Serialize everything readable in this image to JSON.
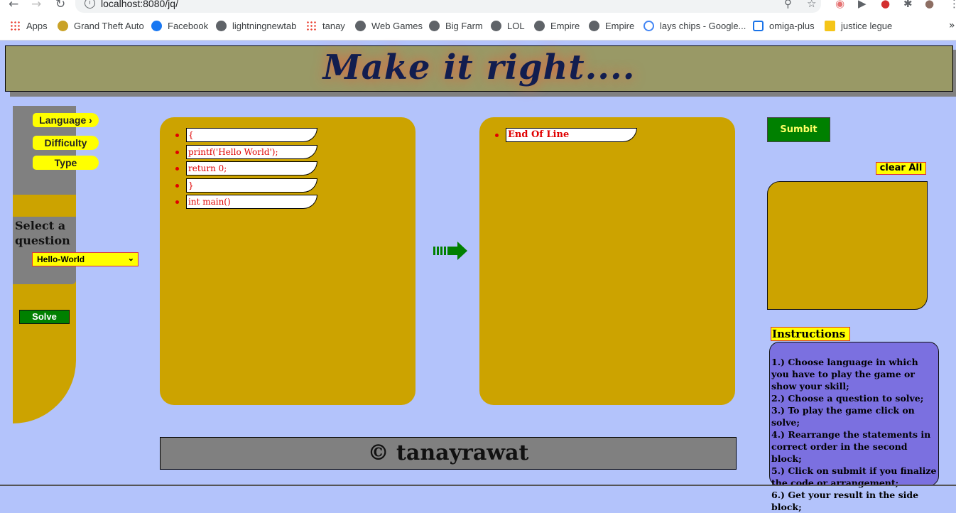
{
  "browser": {
    "url": "localhost:8080/jq/",
    "bookmarks": [
      "Apps",
      "Grand Theft Auto",
      "Facebook",
      "lightningnewtab",
      "tanay",
      "Web Games",
      "Big Farm",
      "LOL",
      "Empire",
      "Empire",
      "lays chips - Google...",
      "omiga-plus",
      "justice legue"
    ],
    "bookmark_icons": [
      "apps-grid-icon",
      "gta-icon",
      "facebook-icon",
      "globe-icon",
      "apps-grid-icon",
      "globe-icon",
      "globe-icon",
      "globe-icon",
      "globe-icon",
      "globe-icon",
      "google-icon",
      "omiga-icon",
      "imdb-icon"
    ]
  },
  "header": {
    "title": "Make it right...."
  },
  "sidebar": {
    "menu": [
      "Language ›",
      "Difficulty",
      "Type"
    ],
    "select_label": "Select a question",
    "select_value": "Hello-World",
    "solve_label": "Solve"
  },
  "source_block": {
    "statements": [
      "{",
      "printf('Hello World');",
      "return 0;",
      "}",
      "int main()"
    ]
  },
  "target_block": {
    "statements": [
      "End Of Line"
    ]
  },
  "actions": {
    "submit_label": "Sumbit",
    "clear_label": "clear All"
  },
  "instructions": {
    "title": "Instructions",
    "lines": [
      "1.) Choose language in which you have to play the game or show your skill;",
      "2.) Choose a question to solve;",
      "3.) To play the game click on solve;",
      "4.) Rearrange the statements in correct order in the second block;",
      "5.) Click on submit if you finalize the code or arrangement;",
      "6.) Get your result in the side block;"
    ]
  },
  "footer": {
    "text": "© tanayrawat"
  },
  "colors": {
    "gold": "#cca300",
    "page_bg": "#b3c3fb",
    "green": "#008000",
    "yellow": "#ffff00",
    "instruction_bg": "#7b70e0"
  }
}
